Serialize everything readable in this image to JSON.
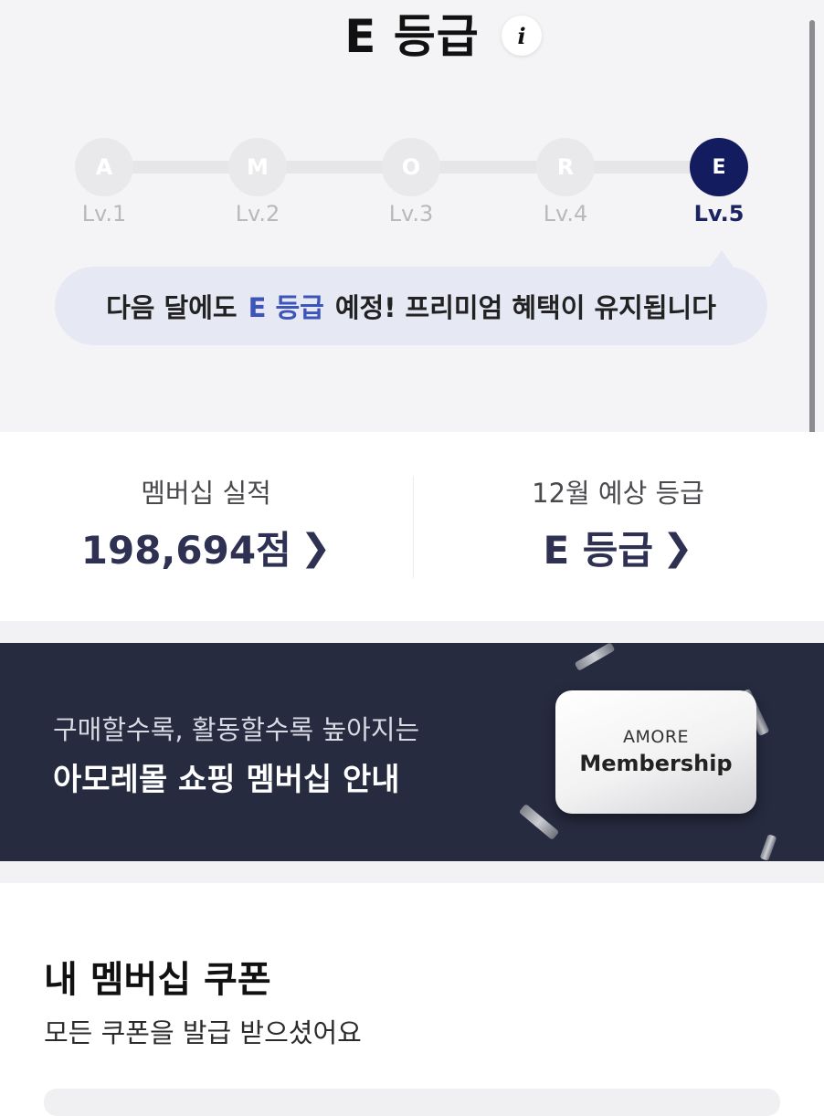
{
  "header": {
    "grade_title": "E 등급",
    "info_label": "i"
  },
  "levels": [
    {
      "letter": "A",
      "label": "Lv.1",
      "active": false
    },
    {
      "letter": "M",
      "label": "Lv.2",
      "active": false
    },
    {
      "letter": "O",
      "label": "Lv.3",
      "active": false
    },
    {
      "letter": "R",
      "label": "Lv.4",
      "active": false
    },
    {
      "letter": "E",
      "label": "Lv.5",
      "active": true
    }
  ],
  "notice": {
    "prefix": "다음 달에도",
    "highlight": "E 등급",
    "suffix": "예정! 프리미엄 혜택이 유지됩니다"
  },
  "stats": {
    "membership": {
      "label": "멤버십 실적",
      "value": "198,694점"
    },
    "forecast": {
      "label": "12월 예상 등급",
      "value": "E 등급"
    }
  },
  "banner": {
    "subtitle": "구매할수록, 활동할수록 높아지는",
    "title": "아모레몰 쇼핑 멤버십 안내",
    "card_top": "AMORE",
    "card_bottom": "Membership"
  },
  "coupons": {
    "title": "내 멤버십 쿠폰",
    "subtitle": "모든 쿠폰을 발급 받으셨어요"
  },
  "colors": {
    "active_level": "#121c5e",
    "highlight": "#3d55b8",
    "banner_bg": "#262b40",
    "stat_value": "#2e3152"
  }
}
